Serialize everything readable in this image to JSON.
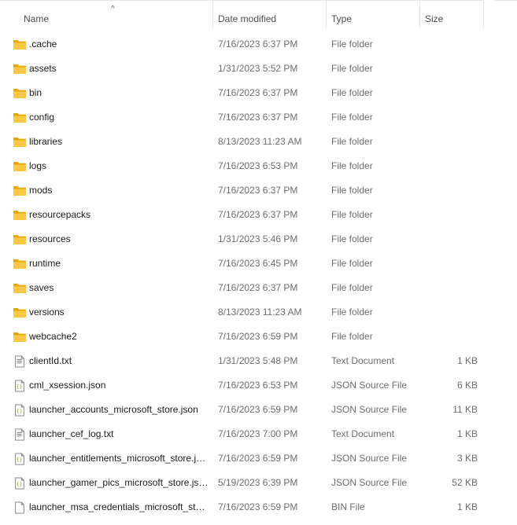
{
  "header": {
    "name": "Name",
    "date_modified": "Date modified",
    "type": "Type",
    "size": "Size",
    "sort_indicator": "^"
  },
  "files": [
    {
      "name": ".cache",
      "date": "7/16/2023 6:37 PM",
      "type": "File folder",
      "size": "",
      "icon": "folder-icon"
    },
    {
      "name": "assets",
      "date": "1/31/2023 5:52 PM",
      "type": "File folder",
      "size": "",
      "icon": "folder-icon"
    },
    {
      "name": "bin",
      "date": "7/16/2023 6:37 PM",
      "type": "File folder",
      "size": "",
      "icon": "folder-icon"
    },
    {
      "name": "config",
      "date": "7/16/2023 6:37 PM",
      "type": "File folder",
      "size": "",
      "icon": "folder-icon"
    },
    {
      "name": "libraries",
      "date": "8/13/2023 11:23 AM",
      "type": "File folder",
      "size": "",
      "icon": "folder-icon"
    },
    {
      "name": "logs",
      "date": "7/16/2023 6:53 PM",
      "type": "File folder",
      "size": "",
      "icon": "folder-icon"
    },
    {
      "name": "mods",
      "date": "7/16/2023 6:37 PM",
      "type": "File folder",
      "size": "",
      "icon": "folder-icon"
    },
    {
      "name": "resourcepacks",
      "date": "7/16/2023 6:37 PM",
      "type": "File folder",
      "size": "",
      "icon": "folder-icon"
    },
    {
      "name": "resources",
      "date": "1/31/2023 5:46 PM",
      "type": "File folder",
      "size": "",
      "icon": "folder-icon"
    },
    {
      "name": "runtime",
      "date": "7/16/2023 6:45 PM",
      "type": "File folder",
      "size": "",
      "icon": "folder-icon"
    },
    {
      "name": "saves",
      "date": "7/16/2023 6:37 PM",
      "type": "File folder",
      "size": "",
      "icon": "folder-icon"
    },
    {
      "name": "versions",
      "date": "8/13/2023 11:23 AM",
      "type": "File folder",
      "size": "",
      "icon": "folder-icon"
    },
    {
      "name": "webcache2",
      "date": "7/16/2023 6:59 PM",
      "type": "File folder",
      "size": "",
      "icon": "folder-icon"
    },
    {
      "name": "clientId.txt",
      "date": "1/31/2023 5:48 PM",
      "type": "Text Document",
      "size": "1 KB",
      "icon": "text-file-icon"
    },
    {
      "name": "cml_xsession.json",
      "date": "7/16/2023 6:53 PM",
      "type": "JSON Source File",
      "size": "6 KB",
      "icon": "json-file-icon"
    },
    {
      "name": "launcher_accounts_microsoft_store.json",
      "date": "7/16/2023 6:59 PM",
      "type": "JSON Source File",
      "size": "11 KB",
      "icon": "json-file-icon"
    },
    {
      "name": "launcher_cef_log.txt",
      "date": "7/16/2023 7:00 PM",
      "type": "Text Document",
      "size": "1 KB",
      "icon": "text-file-icon"
    },
    {
      "name": "launcher_entitlements_microsoft_store.js...",
      "date": "7/16/2023 6:59 PM",
      "type": "JSON Source File",
      "size": "3 KB",
      "icon": "json-file-icon"
    },
    {
      "name": "launcher_gamer_pics_microsoft_store.json",
      "date": "5/19/2023 6:39 PM",
      "type": "JSON Source File",
      "size": "52 KB",
      "icon": "json-file-icon"
    },
    {
      "name": "launcher_msa_credentials_microsoft_stor...",
      "date": "7/16/2023 6:59 PM",
      "type": "BIN File",
      "size": "1 KB",
      "icon": "bin-file-icon"
    }
  ]
}
